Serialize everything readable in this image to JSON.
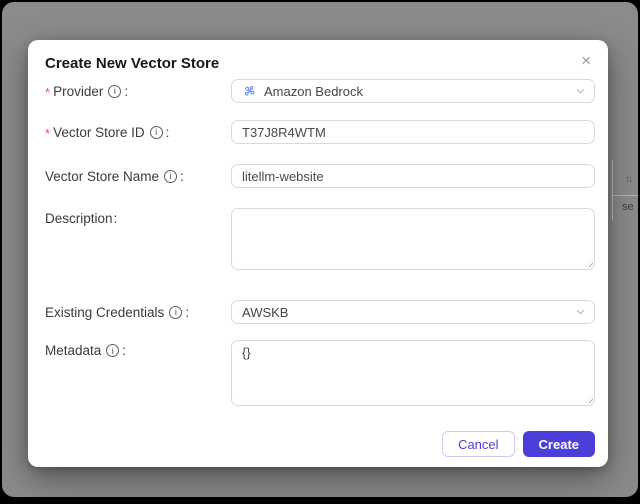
{
  "backdrop": {
    "mask_color": "#8b8b8b",
    "sorter_icon": "↑↓",
    "partial_text": "se"
  },
  "modal": {
    "title": "Create New Vector Store",
    "icons": {
      "close": "×",
      "info": "i"
    },
    "fields": [
      {
        "label": "Provider",
        "required": true,
        "has_info": true,
        "control": "select",
        "value": "Amazon Bedrock"
      },
      {
        "label": "Vector Store ID",
        "required": true,
        "has_info": true,
        "control": "input",
        "value": "T37J8R4WTM"
      },
      {
        "label": "Vector Store Name",
        "required": false,
        "has_info": true,
        "control": "input",
        "value": "litellm-website"
      },
      {
        "label": "Description",
        "required": false,
        "has_info": false,
        "control": "textarea",
        "value": ""
      },
      {
        "label": "Existing Credentials",
        "required": false,
        "has_info": true,
        "control": "select",
        "value": "AWSKB"
      },
      {
        "label": "Metadata",
        "required": false,
        "has_info": true,
        "control": "textarea",
        "value": "{}"
      }
    ],
    "footer": {
      "cancel_label": "Cancel",
      "create_label": "Create"
    },
    "colors": {
      "primary": "#4c3fd9",
      "required_mark": "#ff4d4f",
      "input_border": "#d9d9d9"
    }
  },
  "punctuation": {
    "colon": ":",
    "required_mark": "*"
  }
}
